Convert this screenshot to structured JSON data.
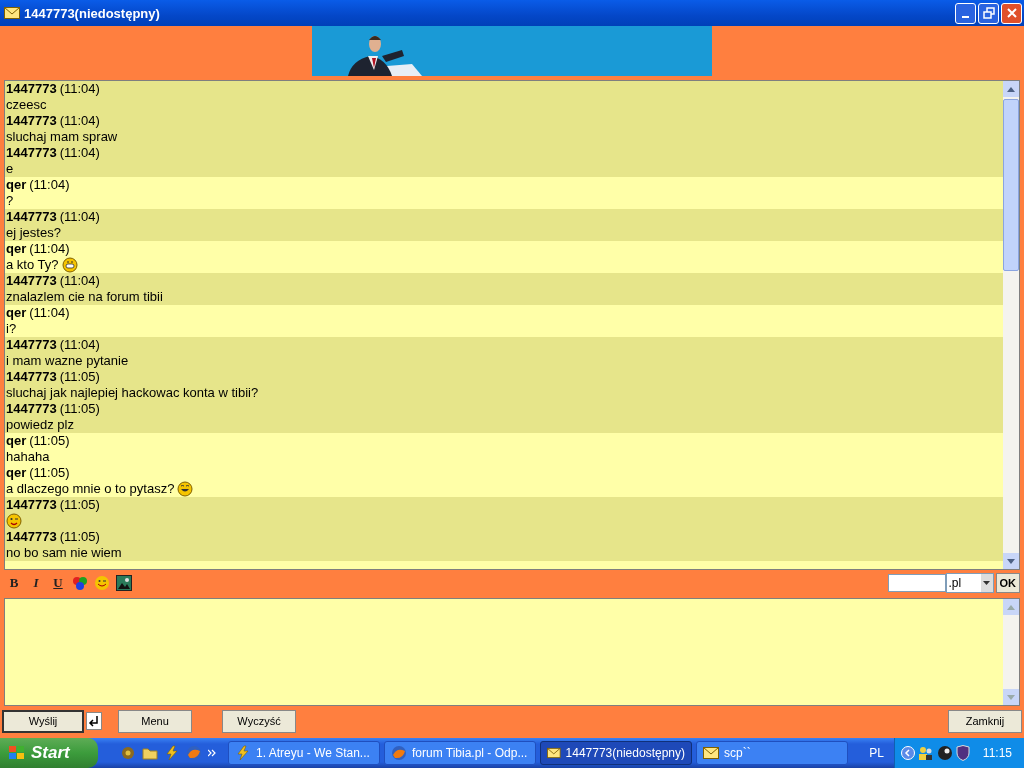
{
  "window": {
    "title": "1447773(niedostępny)"
  },
  "messages": [
    {
      "sender": "1447773",
      "kind": "them",
      "time": "(11:04)",
      "text": "czeesc"
    },
    {
      "sender": "1447773",
      "kind": "them",
      "time": "(11:04)",
      "text": "sluchaj mam spraw"
    },
    {
      "sender": "1447773",
      "kind": "them",
      "time": "(11:04)",
      "text": "e"
    },
    {
      "sender": "qer",
      "kind": "me",
      "time": "(11:04)",
      "text": "?"
    },
    {
      "sender": "1447773",
      "kind": "them",
      "time": "(11:04)",
      "text": "ej jestes?"
    },
    {
      "sender": "qer",
      "kind": "me",
      "time": "(11:04)",
      "text": "a kto Ty?",
      "emoticon": {
        "kind": "grin"
      }
    },
    {
      "sender": "1447773",
      "kind": "them",
      "time": "(11:04)",
      "text": "znalazlem cie na forum tibii"
    },
    {
      "sender": "qer",
      "kind": "me",
      "time": "(11:04)",
      "text": "i?"
    },
    {
      "sender": "1447773",
      "kind": "them",
      "time": "(11:04)",
      "text": "i mam wazne pytanie"
    },
    {
      "sender": "1447773",
      "kind": "them",
      "time": "(11:05)",
      "text": "sluchaj jak najlepiej hackowac konta w tibii?"
    },
    {
      "sender": "1447773",
      "kind": "them",
      "time": "(11:05)",
      "text": "powiedz plz"
    },
    {
      "sender": "qer",
      "kind": "me",
      "time": "(11:05)",
      "text": "hahaha"
    },
    {
      "sender": "qer",
      "kind": "me",
      "time": "(11:05)",
      "text": "a dlaczego mnie o to pytasz?",
      "emoticon": {
        "kind": "laugh"
      }
    },
    {
      "sender": "1447773",
      "kind": "them",
      "time": "(11:05)",
      "emoticon": {
        "kind": "wink"
      }
    },
    {
      "sender": "1447773",
      "kind": "them",
      "time": "(11:05)",
      "text": "no bo sam nie wiem"
    }
  ],
  "format_toolbar": {
    "bold": "B",
    "italic": "I",
    "underline": "U",
    "domain_value": ".pl",
    "ok": "OK"
  },
  "buttons": {
    "send": "Wyślij",
    "menu": "Menu",
    "clear": "Wyczyść",
    "close": "Zamknij"
  },
  "taskbar": {
    "start": "Start",
    "tasks": [
      {
        "label": "1. Atreyu - We Stan...",
        "kind": "music",
        "selected": false
      },
      {
        "label": "forum Tibia.pl - Odp...",
        "kind": "browser",
        "selected": false
      },
      {
        "label": "1447773(niedostępny)",
        "kind": "mail",
        "selected": true
      },
      {
        "label": "scp``",
        "kind": "mail",
        "selected": false
      }
    ],
    "language": "PL",
    "clock": "11:15"
  }
}
